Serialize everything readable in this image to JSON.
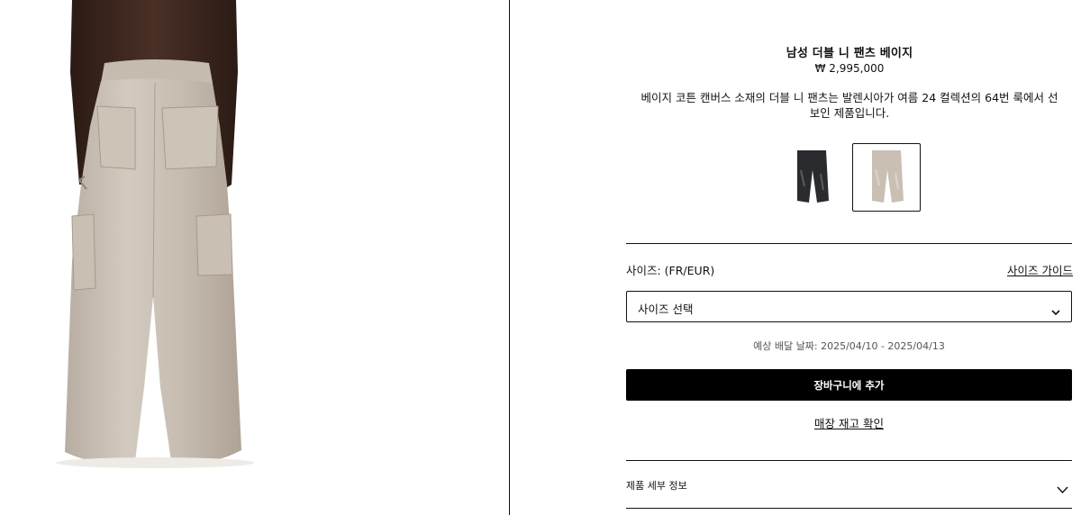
{
  "product": {
    "name": "남성 더블 니 팬츠 베이지",
    "price": "₩ 2,995,000",
    "description": "베이지 코튼 캔버스 소재의 더블 니 팬츠는 발렌시아가 여름 24 컬렉션의 64번 룩에서 선보인 제품입니다."
  },
  "colors": [
    {
      "name": "black-pants",
      "hex": "#2a2b2e",
      "selected": false
    },
    {
      "name": "beige-pants",
      "hex": "#c9bfb3",
      "selected": true
    }
  ],
  "size": {
    "label": "사이즈: (FR/EUR)",
    "guide_link": "사이즈 가이드",
    "select_placeholder": "사이즈 선택"
  },
  "delivery": "예상 배달 날짜: 2025/04/10 - 2025/04/13",
  "add_to_cart": "장바구니에 추가",
  "store_stock": "매장 재고 확인",
  "accordion": {
    "details": "제품 세부 정보"
  }
}
